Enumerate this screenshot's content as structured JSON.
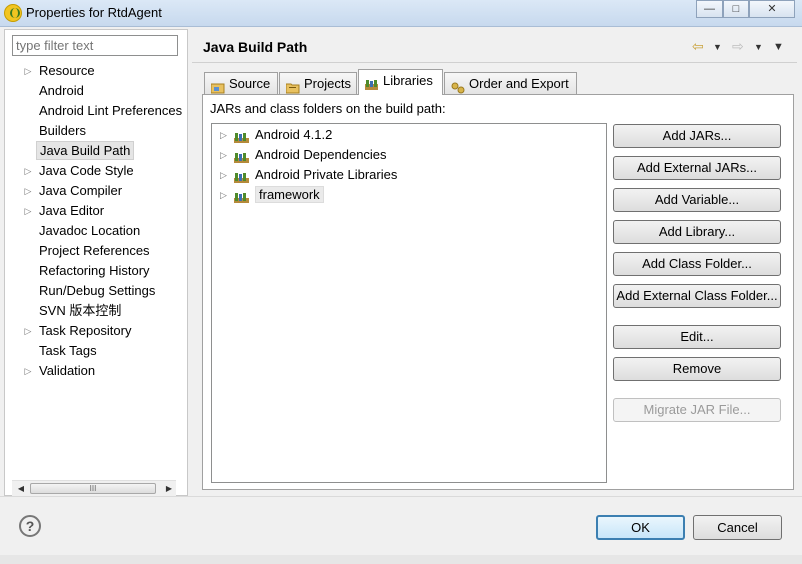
{
  "window": {
    "title": "Properties for RtdAgent",
    "minimize_glyph": "—",
    "maximize_glyph": "□",
    "close_glyph": "✕"
  },
  "left": {
    "filter_placeholder": "type filter text",
    "items": [
      {
        "label": "Resource",
        "expandable": true
      },
      {
        "label": "Android",
        "expandable": false
      },
      {
        "label": "Android Lint Preferences",
        "expandable": false
      },
      {
        "label": "Builders",
        "expandable": false
      },
      {
        "label": "Java Build Path",
        "expandable": false,
        "selected": true
      },
      {
        "label": "Java Code Style",
        "expandable": true
      },
      {
        "label": "Java Compiler",
        "expandable": true
      },
      {
        "label": "Java Editor",
        "expandable": true
      },
      {
        "label": "Javadoc Location",
        "expandable": false
      },
      {
        "label": "Project References",
        "expandable": false
      },
      {
        "label": "Refactoring History",
        "expandable": false
      },
      {
        "label": "Run/Debug Settings",
        "expandable": false
      },
      {
        "label": "SVN 版本控制",
        "expandable": false
      },
      {
        "label": "Task Repository",
        "expandable": true
      },
      {
        "label": "Task Tags",
        "expandable": false
      },
      {
        "label": "Validation",
        "expandable": true
      }
    ],
    "scroll_thumb_glyph": "III"
  },
  "page": {
    "title": "Java Build Path",
    "tabs": [
      {
        "label": "Source",
        "icon": "source-folder-icon"
      },
      {
        "label": "Projects",
        "icon": "projects-folder-icon"
      },
      {
        "label": "Libraries",
        "icon": "libraries-icon",
        "active": true
      },
      {
        "label": "Order and Export",
        "icon": "order-export-icon"
      }
    ],
    "list_label": "JARs and class folders on the build path:",
    "libraries": [
      {
        "label": "Android 4.1.2"
      },
      {
        "label": "Android Dependencies"
      },
      {
        "label": "Android Private Libraries"
      },
      {
        "label": "framework",
        "selected": true
      }
    ],
    "buttons": {
      "add_jars": "Add JARs...",
      "add_external_jars": "Add External JARs...",
      "add_variable": "Add Variable...",
      "add_library": "Add Library...",
      "add_class_folder": "Add Class Folder...",
      "add_external_class_folder": "Add External Class Folder...",
      "edit": "Edit...",
      "remove": "Remove",
      "migrate_jar": "Migrate JAR File..."
    }
  },
  "footer": {
    "help_glyph": "?",
    "ok": "OK",
    "cancel": "Cancel"
  },
  "colors": {
    "accent_default_button": "#3c7fb1",
    "title_bar": "#c7d9ee",
    "jar_icon_green": "#4f8a2a",
    "jar_icon_brown": "#b58a3a"
  }
}
